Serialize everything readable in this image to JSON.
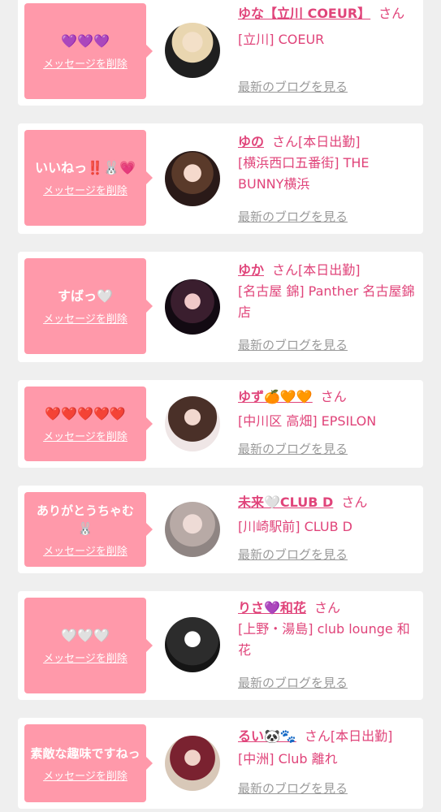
{
  "delete_label": "メッセージを削除",
  "blog_label": "最新のブログを見る",
  "san": "さん",
  "colors": {
    "accent": "#e0447a",
    "bubble": "#ff99aa",
    "link_gray": "#9a9a9a"
  },
  "cards": [
    {
      "message": "💜💜💜",
      "name": "ゆな【立川 COEUR】",
      "status": "",
      "shop": "[立川] COEUR"
    },
    {
      "message": "いいねっ‼️🐰💗",
      "name": "ゆの",
      "status": "[本日出勤]",
      "shop": "[横浜西口五番街] THE BUNNY横浜"
    },
    {
      "message": "すばっ🤍",
      "name": "ゆか",
      "status": "[本日出勤]",
      "shop": "[名古屋 錦] Panther 名古屋錦店"
    },
    {
      "message": "❤️❤️❤️❤️❤️",
      "name": "ゆず🍊🧡🧡",
      "status": "",
      "shop": "[中川区 高畑] EPSILON"
    },
    {
      "message": "ありがとうちゃむ🐰",
      "name": "未来🤍CLUB D",
      "status": "",
      "shop": "[川崎駅前] CLUB D"
    },
    {
      "message": "🤍🤍🤍",
      "name": "りさ💜和花",
      "status": "",
      "shop": "[上野・湯島] club lounge 和花"
    },
    {
      "message": "素敵な趣味ですねっ",
      "name": "るい🐼🐾",
      "status": "[本日出勤]",
      "shop": "[中洲] Club 離れ"
    }
  ]
}
